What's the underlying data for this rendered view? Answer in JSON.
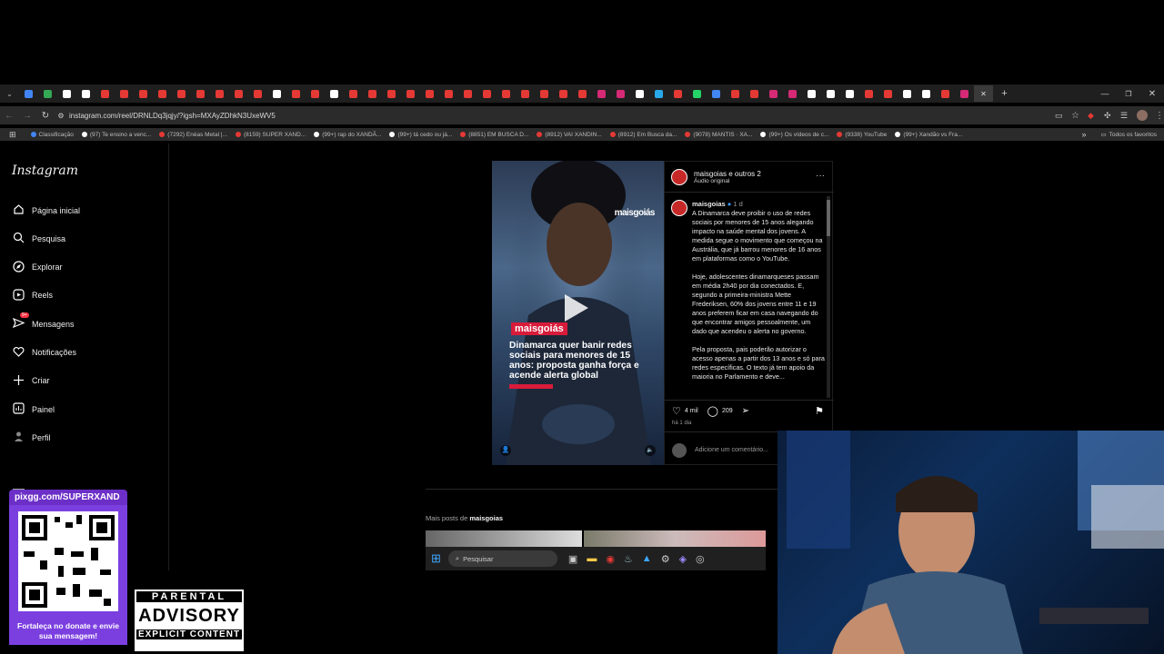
{
  "browser": {
    "url": "instagram.com/reel/DRNLDq3jqjy/?igsh=MXAyZDhkN3UxeWV5",
    "tab_favicon_colors": [
      "#4285f4",
      "#34a853",
      "#ffffff",
      "#ffffff",
      "#e53935",
      "#e53935",
      "#e53935",
      "#e53935",
      "#e53935",
      "#e53935",
      "#e53935",
      "#e53935",
      "#e53935",
      "#ffffff",
      "#e53935",
      "#e53935",
      "#ffffff",
      "#e53935",
      "#e53935",
      "#e53935",
      "#e53935",
      "#e53935",
      "#e53935",
      "#e53935",
      "#e53935",
      "#e53935",
      "#e53935",
      "#e53935",
      "#e53935",
      "#e53935",
      "#d62976",
      "#d62976",
      "#ffffff",
      "#29a9eb",
      "#e53935",
      "#25d366",
      "#4285f4",
      "#e53935",
      "#e53935",
      "#d62976",
      "#d62976",
      "#ffffff",
      "#ffffff",
      "#ffffff",
      "#e53935",
      "#e53935",
      "#ffffff",
      "#ffffff",
      "#e53935",
      "#d62976"
    ],
    "bookmarks": [
      {
        "label": "Classificação",
        "color": "#4285f4"
      },
      {
        "label": "(97) Te ensino a venc...",
        "color": "#ffffff"
      },
      {
        "label": "(7292) Enéas Metal |...",
        "color": "#e53935"
      },
      {
        "label": "(8159) SUPER XAND...",
        "color": "#e53935"
      },
      {
        "label": "(99+) rap do XANDÃ...",
        "color": "#ffffff"
      },
      {
        "label": "(99+) tá cedo ou já...",
        "color": "#ffffff"
      },
      {
        "label": "(8851) EM BUSCA D...",
        "color": "#e53935"
      },
      {
        "label": "(8912) VAI XANDIN...",
        "color": "#e53935"
      },
      {
        "label": "(8912) Em Busca da...",
        "color": "#e53935"
      },
      {
        "label": "(9078) MANTIS · XA...",
        "color": "#e53935"
      },
      {
        "label": "(99+) Os vídeos de c...",
        "color": "#ffffff"
      },
      {
        "label": "(9338) YouTube",
        "color": "#e53935"
      },
      {
        "label": "(99+) Xandão vs Fra...",
        "color": "#ffffff"
      }
    ],
    "all_bookmarks": "Todos os favoritos"
  },
  "instagram": {
    "logo": "Instagram",
    "nav": [
      {
        "label": "Página inicial",
        "icon": "home-icon"
      },
      {
        "label": "Pesquisa",
        "icon": "search-icon"
      },
      {
        "label": "Explorar",
        "icon": "compass-icon"
      },
      {
        "label": "Reels",
        "icon": "reels-icon"
      },
      {
        "label": "Mensagens",
        "icon": "messenger-icon"
      },
      {
        "label": "Notificações",
        "icon": "heart-icon"
      },
      {
        "label": "Criar",
        "icon": "plus-icon"
      },
      {
        "label": "Painel",
        "icon": "dashboard-icon"
      },
      {
        "label": "Perfil",
        "icon": "profile-icon"
      }
    ],
    "messages_badge": "9+",
    "post": {
      "header_account": "maisgoias e outros 2",
      "header_audio": "Áudio original",
      "username": "maisgoias",
      "time_ago": "1 d",
      "caption_paragraphs": [
        "A Dinamarca deve proibir o uso de redes sociais por menores de 15 anos alegando impacto na saúde mental dos jovens. A medida segue o movimento que começou na Austrália, que já barrou menores de 16 anos em plataformas como o YouTube.",
        "Hoje, adolescentes dinamarqueses passam em média 2h40 por dia conectados. E, segundo a primeira-ministra Mette Frederiksen, 60% dos jovens entre 11 e 19 anos preferem ficar em casa navegando do que encontrar amigos pessoalmente, um dado que acendeu o alerta no governo.",
        "Pela proposta, pais poderão autorizar o acesso apenas a partir dos 13 anos e só para redes específicas. O texto já tem apoio da maioria no Parlamento e deve..."
      ],
      "likes": "4 mil",
      "comments": "209",
      "posted": "há 1 dia",
      "comment_placeholder": "Adicione um comentário..."
    },
    "video": {
      "watermark": "maisgoiás",
      "brand_tag": "maisgoiás",
      "headline": "Dinamarca quer banir redes sociais para menores de 15 anos: proposta ganha força e acende alerta global"
    },
    "more_posts_prefix": "Mais posts de",
    "more_posts_user": "maisgoias"
  },
  "taskbar": {
    "search_placeholder": "Pesquisar"
  },
  "overlay": {
    "pix_url": "pixgg.com/SUPERXAND",
    "pix_cta": "Fortaleça no donate e envie sua mensagem!",
    "advisory_top": "PARENTAL",
    "advisory_mid": "ADVISORY",
    "advisory_bottom": "EXPLICIT CONTENT"
  }
}
